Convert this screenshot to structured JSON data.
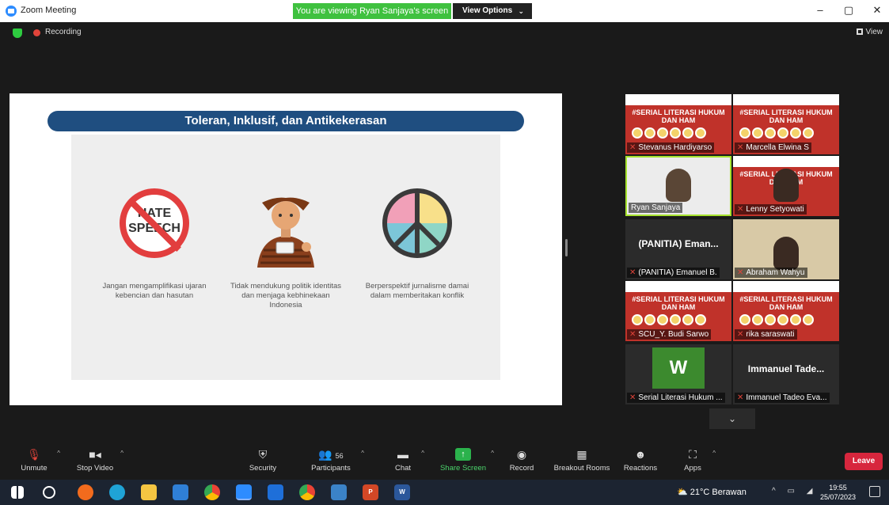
{
  "window": {
    "title": "Zoom Meeting",
    "viewing_banner": "You are viewing Ryan Sanjaya's screen",
    "view_options": "View Options"
  },
  "topbar": {
    "recording": "Recording",
    "view": "View"
  },
  "slide": {
    "title": "Toleran, Inklusif, dan Antikekerasan",
    "items": [
      {
        "icon": "hate-speech-sign-icon",
        "icon_text": "HATE SPEECH",
        "caption": "Jangan mengamplifikasi ujaran kebencian dan hasutan"
      },
      {
        "icon": "person-coffee-icon",
        "caption": "Tidak mendukung politik identitas dan menjaga kebhinekaan Indonesia"
      },
      {
        "icon": "peace-sign-icon",
        "caption": "Berperspektif jurnalisme damai dalam memberitakan konflik"
      }
    ]
  },
  "gallery": {
    "poster_text": "#SERIAL LITERASI HUKUM DAN HAM",
    "participants": [
      {
        "name": "Stevanus Hardiyarso",
        "muted": true,
        "kind": "poster"
      },
      {
        "name": "Marcella Elwina S",
        "muted": true,
        "kind": "poster"
      },
      {
        "name": "Ryan Sanjaya",
        "muted": false,
        "kind": "video"
      },
      {
        "name": "Lenny Setyowati",
        "muted": true,
        "kind": "poster"
      },
      {
        "name": "(PANITIA) Emanuel B.",
        "display": "(PANITIA) Eman...",
        "muted": true,
        "kind": "name"
      },
      {
        "name": "Abraham Wahyu",
        "muted": true,
        "kind": "video"
      },
      {
        "name": "SCU_Y. Budi Sarwo",
        "muted": true,
        "kind": "poster"
      },
      {
        "name": "rika saraswati",
        "muted": true,
        "kind": "poster"
      },
      {
        "name": "Serial Literasi Hukum ...",
        "avatar_letter": "W",
        "muted": true,
        "kind": "avatar"
      },
      {
        "name": "Immanuel Tadeo Eva...",
        "display": "Immanuel Tade...",
        "muted": true,
        "kind": "name"
      }
    ]
  },
  "toolbar": {
    "unmute": "Unmute",
    "stop_video": "Stop Video",
    "security": "Security",
    "participants": "Participants",
    "participants_count": "56",
    "chat": "Chat",
    "share_screen": "Share Screen",
    "record": "Record",
    "breakout_rooms": "Breakout Rooms",
    "reactions": "Reactions",
    "apps": "Apps",
    "leave": "Leave"
  },
  "taskbar": {
    "weather": "21°C Berawan",
    "time": "19:55",
    "date": "25/07/2023"
  },
  "colors": {
    "share_green": "#2bb24c",
    "leave_red": "#d7263d",
    "slide_title_bg": "#1f4e80",
    "banner_green": "#3fc13f"
  }
}
